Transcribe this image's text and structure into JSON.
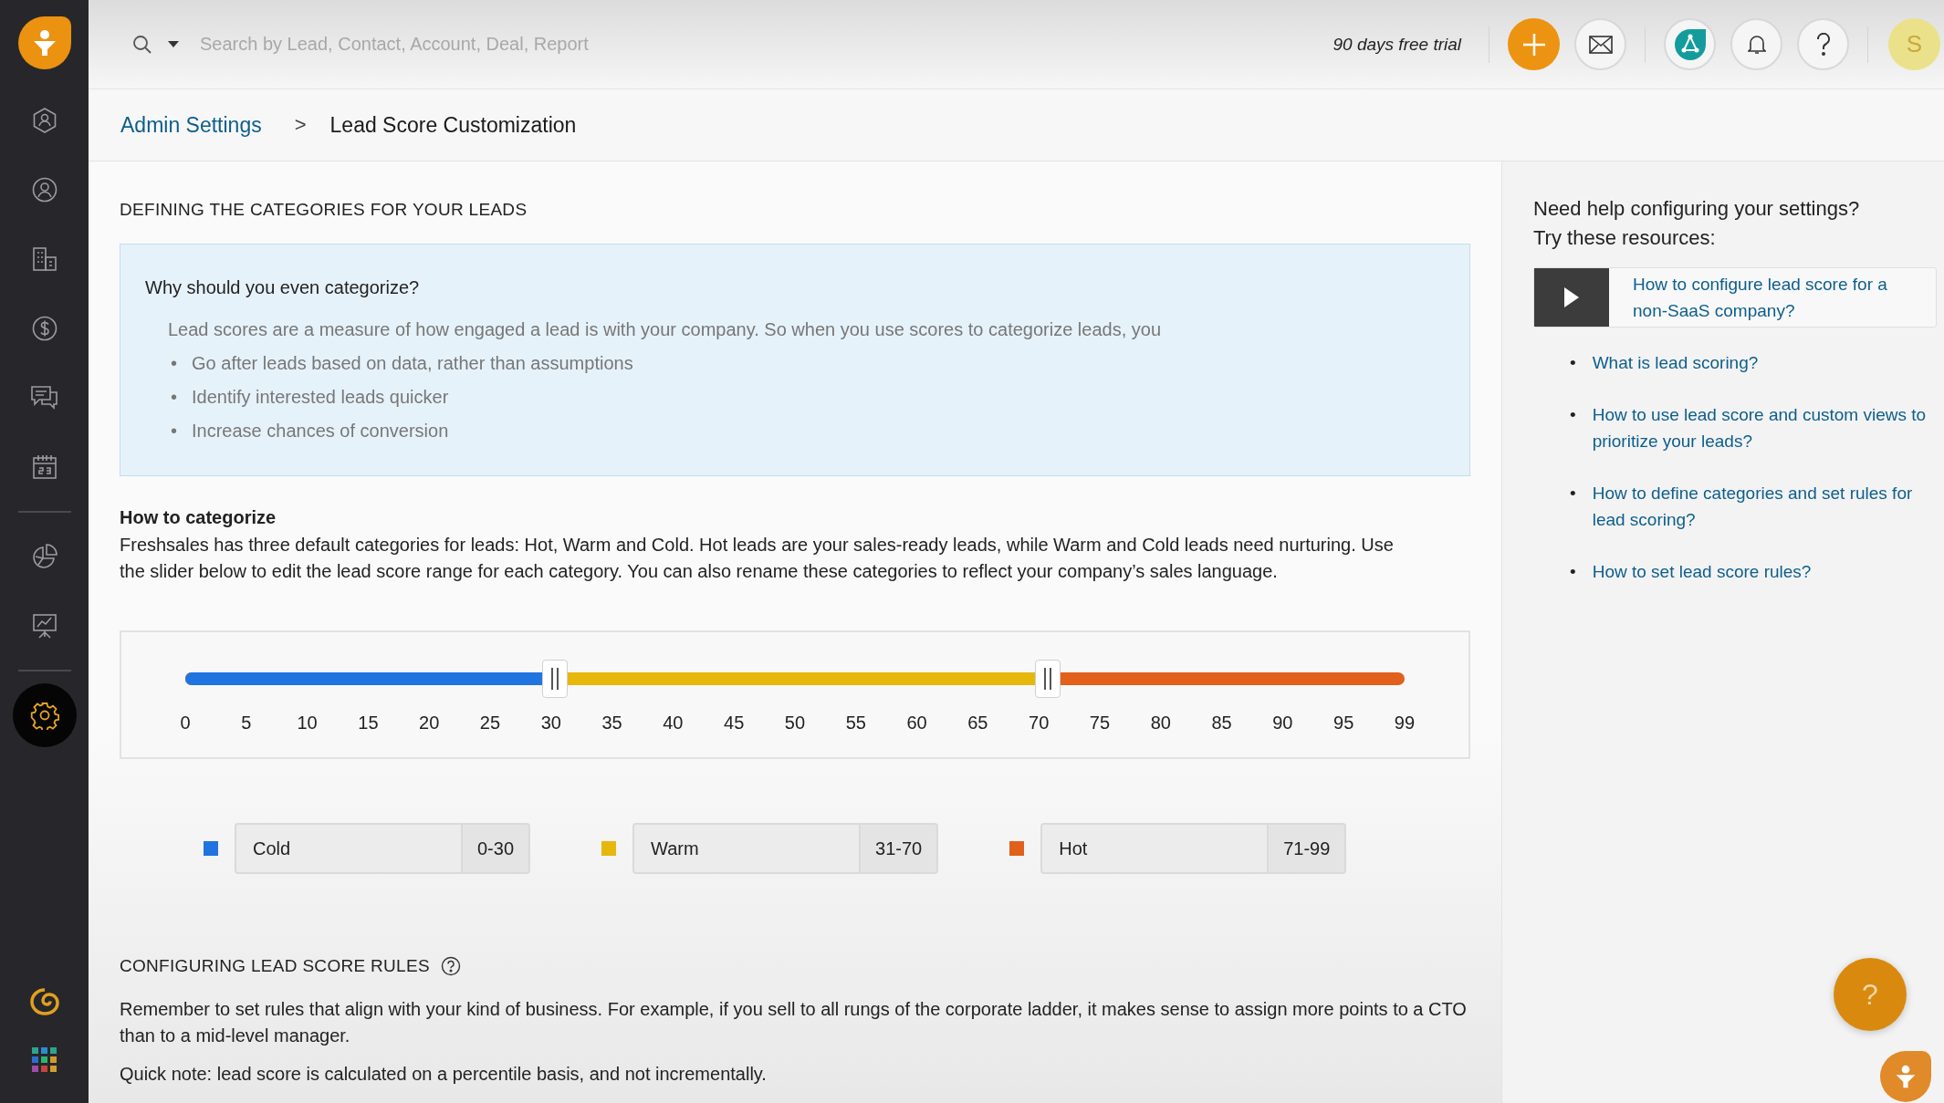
{
  "sidebar": {
    "items": [
      {
        "selected": false
      },
      {
        "selected": false
      },
      {
        "selected": false
      },
      {
        "selected": false
      },
      {
        "selected": false
      },
      {
        "selected": false
      },
      {
        "selected": false
      },
      {
        "selected": false
      },
      {
        "selected": true
      }
    ]
  },
  "top_bar": {
    "search": {
      "placeholder": "Search by Lead, Contact, Account, Deal, Report"
    },
    "trial": "90 days free trial",
    "avatar": "S"
  },
  "breadcrumb": {
    "parent": "Admin Settings",
    "separator": ">",
    "current": "Lead Score Customization"
  },
  "categories_section": {
    "title": "DEFINING THE CATEGORIES FOR YOUR LEADS",
    "info": {
      "question": "Why should you even categorize?",
      "intro": "Lead scores are a measure of how engaged a lead is with your company. So when you use scores to categorize leads, you",
      "bullets": [
        {
          "marker": "•",
          "text": "Go after leads based on data, rather than assumptions"
        },
        {
          "marker": "•",
          "text": "Identify interested leads quicker"
        },
        {
          "marker": "•",
          "text": "Increase chances of conversion"
        }
      ]
    },
    "how_title": "How to categorize",
    "how_text": "Freshsales has three default categories for leads: Hot, Warm and Cold. Hot leads are your sales-ready leads, while Warm and Cold leads need nurturing. Use the slider below to edit the lead score range for each category. You can also rename these categories to reflect your company’s sales language."
  },
  "slider": {
    "thumbs": [
      {
        "level": 0.303
      },
      {
        "level": 0.707
      }
    ],
    "ticks": [
      "0",
      "5",
      "10",
      "15",
      "20",
      "25",
      "30",
      "35",
      "40",
      "45",
      "50",
      "55",
      "60",
      "65",
      "70",
      "75",
      "80",
      "85",
      "90",
      "95",
      "99"
    ]
  },
  "categories": [
    {
      "name": "Cold",
      "range": "0-30",
      "color": "#1f74e0"
    },
    {
      "name": "Warm",
      "range": "31-70",
      "color": "#e6b80c"
    },
    {
      "name": "Hot",
      "range": "71-99",
      "color": "#e0601c"
    }
  ],
  "rules": {
    "title": "CONFIGURING LEAD SCORE RULES",
    "text": "Remember to set rules that align with your kind of business. For example, if you sell to all rungs of the corporate ladder, it makes sense to assign more points to a CTO than to a mid-level manager.",
    "note": "Quick note: lead score is calculated on a percentile basis, and not incrementally."
  },
  "help_panel": {
    "title_lines": [
      "Need help configuring your settings?",
      "Try these resources:"
    ],
    "video": {
      "title": "How to configure lead score for a non-SaaS company?"
    },
    "links": [
      {
        "marker": "•",
        "text": "What is lead scoring?"
      },
      {
        "marker": "•",
        "text": "How to use lead score and custom views to prioritize your leads?"
      },
      {
        "marker": "•",
        "text": "How to define categories and set rules for lead scoring?"
      },
      {
        "marker": "•",
        "text": "How to set lead score rules?"
      }
    ]
  },
  "help_fab": "?"
}
